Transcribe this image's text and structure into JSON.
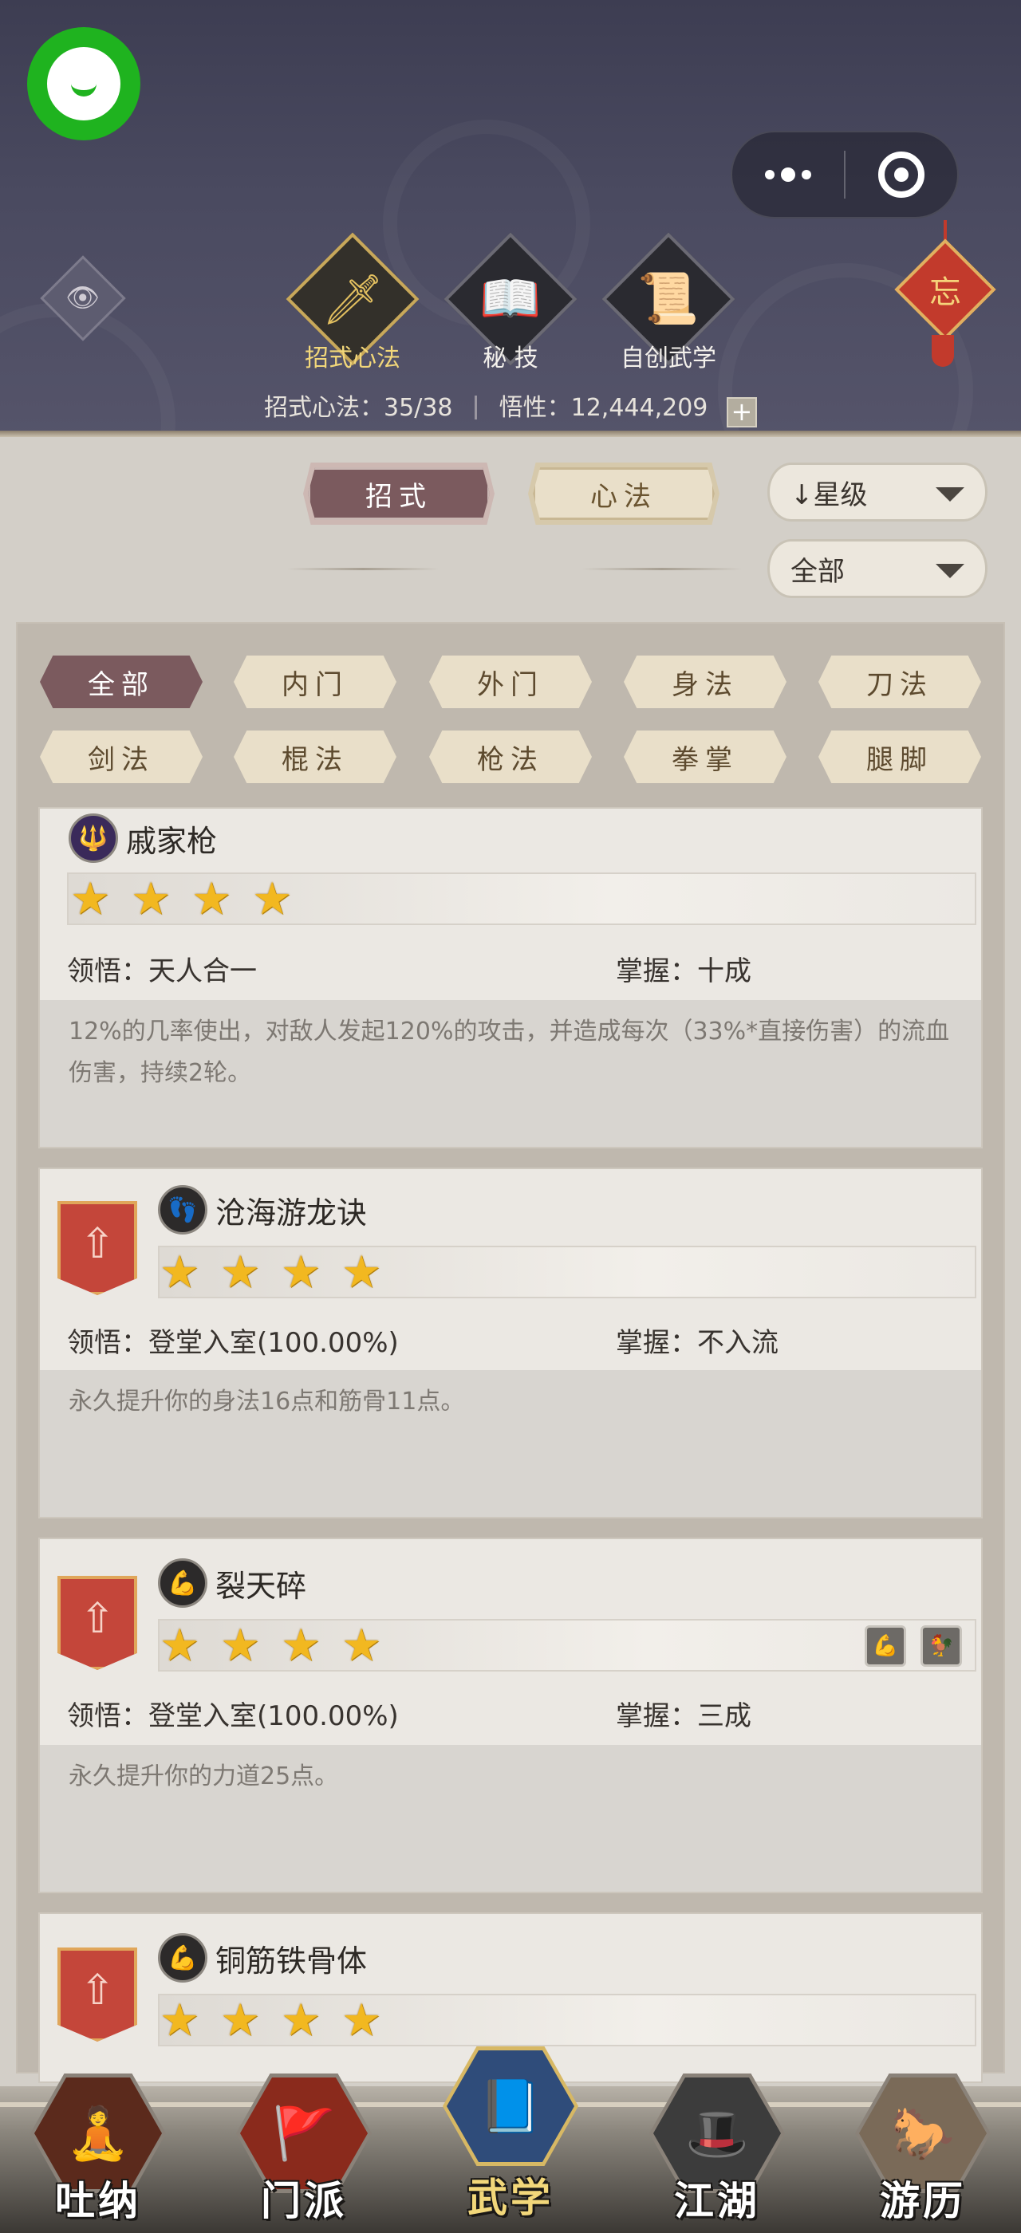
{
  "header": {
    "tabs": [
      {
        "label": "招式心法",
        "icon": "sword-icon",
        "glyph": "🗡",
        "active": true
      },
      {
        "label": "秘 技",
        "icon": "book-icon",
        "glyph": "📖",
        "active": false
      },
      {
        "label": "自创武学",
        "icon": "scroll-icon",
        "glyph": "📜",
        "active": false
      }
    ],
    "stats": {
      "moves_label": "招式心法：35/38",
      "insight_label": "悟性：12,444,209",
      "plus": "+"
    },
    "knot_char": "忘",
    "eye_glyph": "👁"
  },
  "controls": {
    "tab_moves": "招式",
    "tab_mental": "心法",
    "sort_label": "↓星级",
    "filter_label": "全部"
  },
  "filters": [
    "全部",
    "内门",
    "外门",
    "身法",
    "刀法",
    "剑法",
    "棍法",
    "枪法",
    "拳掌",
    "腿脚"
  ],
  "skills": [
    {
      "name": "戚家枪",
      "stars": 4,
      "comprehension": "领悟：天人合一",
      "mastery": "掌握：十成",
      "description": "12%的几率使出，对敌人发起120%的攻击，并造成每次（33%*直接伤害）的流血伤害，持续2轮。",
      "icon_glyph": "🔱"
    },
    {
      "name": "沧海游龙诀",
      "stars": 4,
      "comprehension": "领悟：登堂入室(100.00%)",
      "mastery": "掌握：不入流",
      "description": "永久提升你的身法16点和筋骨11点。",
      "icon_glyph": "👣"
    },
    {
      "name": "裂天碎",
      "stars": 4,
      "comprehension": "领悟：登堂入室(100.00%)",
      "mastery": "掌握：三成",
      "description": "永久提升你的力道25点。",
      "icon_glyph": "💪"
    },
    {
      "name": "铜筋铁骨体",
      "stars": 4,
      "icon_glyph": "💪"
    }
  ],
  "mini_icons": [
    "💪",
    "🐓"
  ],
  "badge_glyph": "⇧",
  "nav": [
    {
      "label": "吐纳",
      "glyph": "🧘",
      "bg": "#5b2a1c"
    },
    {
      "label": "门派",
      "glyph": "🚩",
      "bg": "#8a2a1c"
    },
    {
      "label": "武学",
      "glyph": "📘",
      "bg": "#2f4c7a",
      "active": true
    },
    {
      "label": "江湖",
      "glyph": "🎩",
      "bg": "#3c3c3c"
    },
    {
      "label": "游历",
      "glyph": "🐎",
      "bg": "#7a6a58"
    }
  ]
}
